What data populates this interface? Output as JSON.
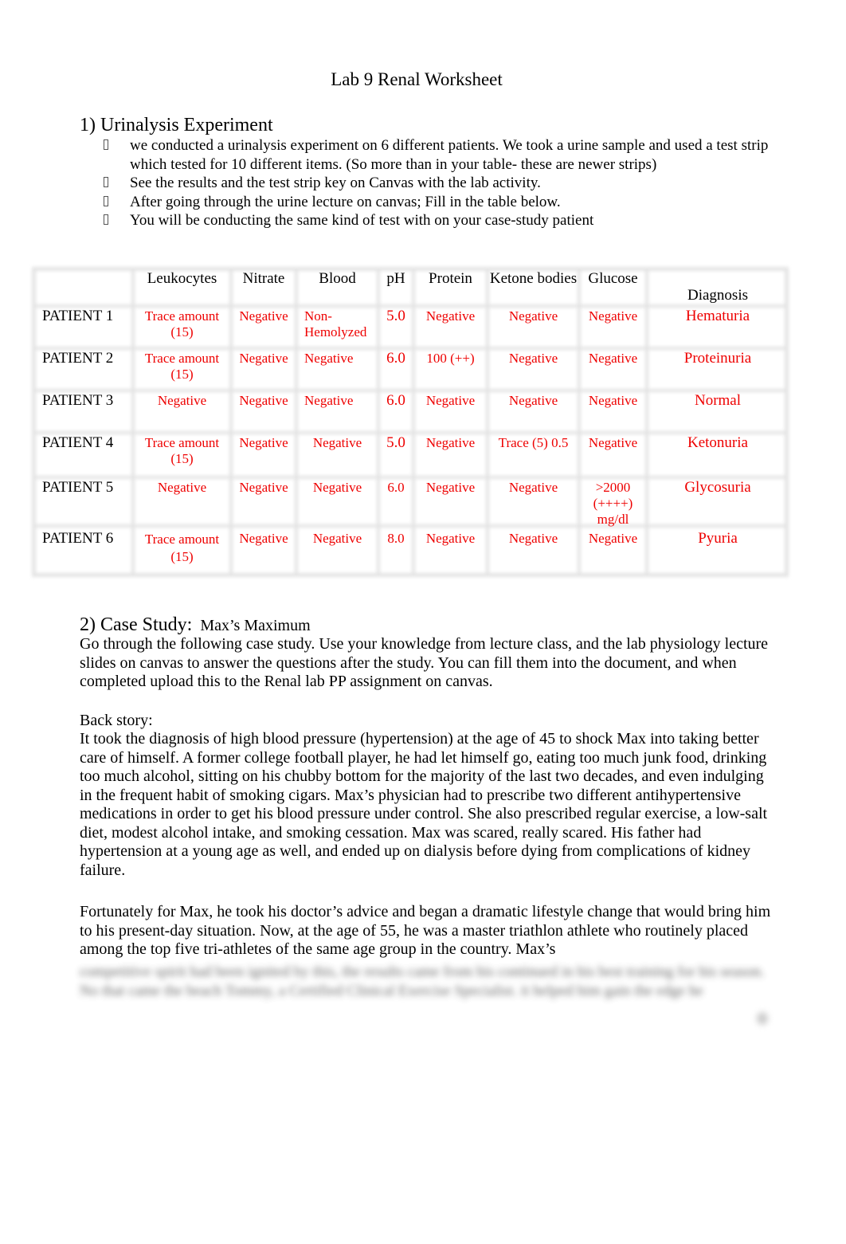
{
  "document": {
    "title": "Lab 9 Renal Worksheet",
    "section1": {
      "heading": "1) Urinalysis Experiment",
      "bullets": [
        "we conducted a urinalysis experiment on 6 different patients.  We took a urine sample and used a test strip which tested for 10 different items.  (So more than in your table- these are newer strips)",
        "See the results and the test strip key on Canvas with the lab activity.",
        "After going through the urine lecture on canvas; Fill in the table below.",
        "You will be conducting the same kind of test with on your case-study patient"
      ],
      "bullet_icon": "missing-glyph-box"
    },
    "table": {
      "headers": [
        "",
        "Leukocytes",
        "Nitrate",
        "Blood",
        "pH",
        "Protein",
        "Ketone bodies",
        "Glucose",
        "Diagnosis"
      ],
      "rows": [
        {
          "patient": "PATIENT 1",
          "leukocytes": "Trace amount (15)",
          "nitrate": "Negative",
          "blood": "Non-Hemolyzed",
          "ph": "5.0",
          "protein": "Negative",
          "ketone": "Negative",
          "glucose": "Negative",
          "diagnosis": "Hematuria"
        },
        {
          "patient": "PATIENT 2",
          "leukocytes": "Trace amount (15)",
          "nitrate": "Negative",
          "blood": "Negative",
          "ph": "6.0",
          "protein": "100 (++)",
          "ketone": "Negative",
          "glucose": "Negative",
          "diagnosis": "Proteinuria"
        },
        {
          "patient": "PATIENT 3",
          "leukocytes": "Negative",
          "nitrate": "Negative",
          "blood": "Negative",
          "ph": "6.0",
          "protein": "Negative",
          "ketone": "Negative",
          "glucose": "Negative",
          "diagnosis": "Normal"
        },
        {
          "patient": "PATIENT 4",
          "leukocytes": "Trace amount (15)",
          "nitrate": "Negative",
          "blood": "Negative",
          "ph": "5.0",
          "protein": "Negative",
          "ketone": "Trace (5) 0.5",
          "glucose": "Negative",
          "diagnosis": "Ketonuria"
        },
        {
          "patient": "PATIENT 5",
          "leukocytes": "Negative",
          "nitrate": "Negative",
          "blood": "Negative",
          "ph": "6.0",
          "protein": "Negative",
          "ketone": "Negative",
          "glucose": ">2000 (++++) mg/dl",
          "diagnosis": "Glycosuria"
        },
        {
          "patient": "PATIENT 6",
          "leukocytes": "Trace amount (15)",
          "nitrate": "Negative",
          "blood": "Negative",
          "ph": "8.0",
          "protein": "Negative",
          "ketone": "Negative",
          "glucose": "Negative",
          "diagnosis": "Pyuria"
        }
      ],
      "answer_color": "#ee0000"
    },
    "section2": {
      "heading": "2) Case Study:",
      "subtitle": "Max’s Maximum",
      "intro": "Go through the following case study. Use your knowledge from lecture class, and the lab physiology lecture slides  on canvas to answer the questions after the study. You can fill them into the document, and when completed upload this to the Renal lab PP assignment on canvas.",
      "backstory_label": "Back story:",
      "backstory_p1": "It took the diagnosis of high blood pressure (hypertension) at the age of 45 to shock Max into taking better care of himself. A former college football player, he had let himself go, eating too much junk food, drinking too much alcohol, sitting on his chubby bottom for the majority of the last two decades, and even indulging in the frequent habit of smoking cigars. Max’s physician had to prescribe two different antihypertensive medications in order to get his blood pressure under control. She also prescribed regular exercise, a low-salt diet, modest alcohol intake, and smoking cessation. Max was scared, really scared. His father had hypertension at a young age as well, and ended up on dialysis before dying from complications of kidney failure.",
      "backstory_p2": "Fortunately for Max, he took his doctor’s advice and began a dramatic lifestyle change that would bring him to his present-day situation. Now, at the age of 55, he was a master triathlon athlete who routinely placed among the top five tri-athletes of the same age group in the country. Max’s",
      "blurred_text": "competitive spirit had been ignited by this, the results came from his continued in his best training for his season. No that came the beach Tommy, a Certified Clinical Exercise Specialist. it helped him gain the edge he"
    }
  }
}
